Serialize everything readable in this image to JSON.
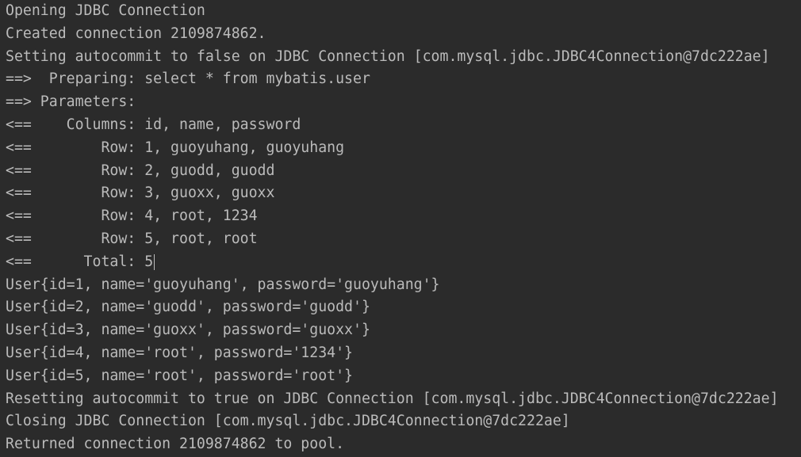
{
  "console": {
    "lines": [
      "Opening JDBC Connection",
      "Created connection 2109874862.",
      "Setting autocommit to false on JDBC Connection [com.mysql.jdbc.JDBC4Connection@7dc222ae]",
      "==>  Preparing: select * from mybatis.user",
      "==> Parameters: ",
      "<==    Columns: id, name, password",
      "<==        Row: 1, guoyuhang, guoyuhang",
      "<==        Row: 2, guodd, guodd",
      "<==        Row: 3, guoxx, guoxx",
      "<==        Row: 4, root, 1234",
      "<==        Row: 5, root, root",
      "<==      Total: 5",
      "User{id=1, name='guoyuhang', password='guoyuhang'}",
      "User{id=2, name='guodd', password='guodd'}",
      "User{id=3, name='guoxx', password='guoxx'}",
      "User{id=4, name='root', password='1234'}",
      "User{id=5, name='root', password='root'}",
      "Resetting autocommit to true on JDBC Connection [com.mysql.jdbc.JDBC4Connection@7dc222ae]",
      "Closing JDBC Connection [com.mysql.jdbc.JDBC4Connection@7dc222ae]",
      "Returned connection 2109874862 to pool."
    ]
  },
  "colors": {
    "background": "#2b2b2b",
    "text": "#bbbbbb"
  }
}
